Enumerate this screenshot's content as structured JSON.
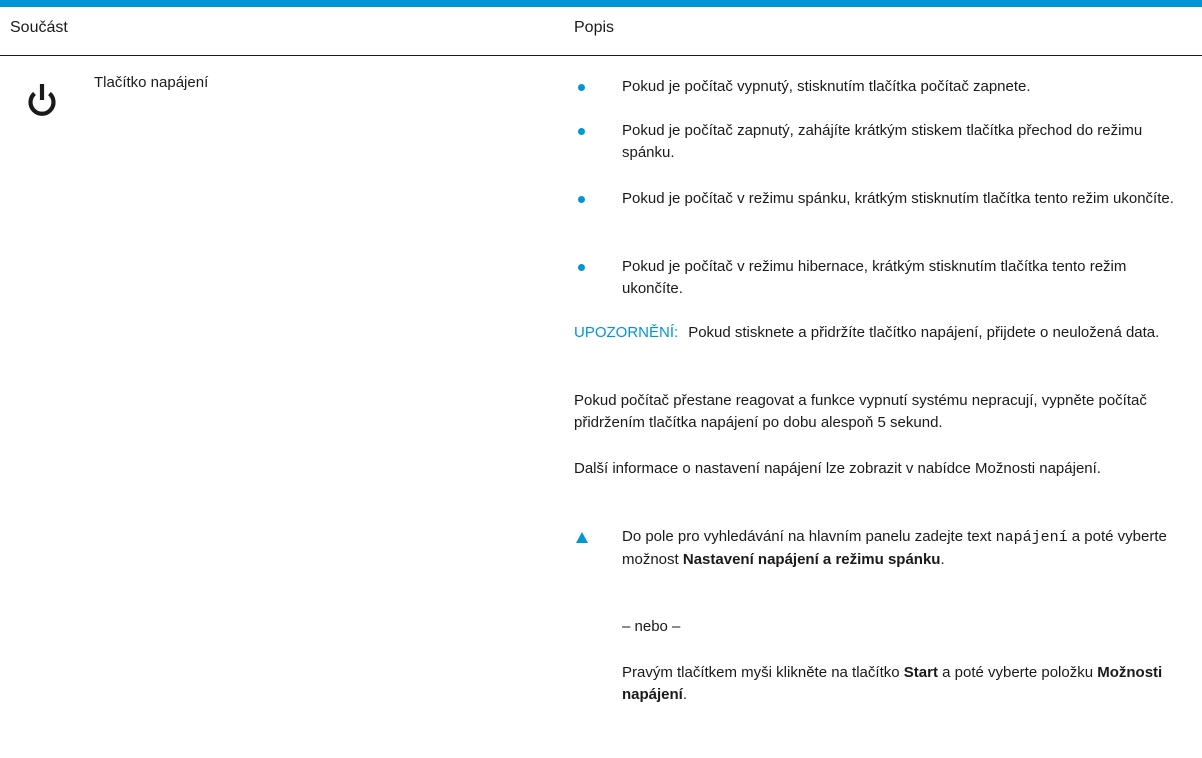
{
  "table": {
    "headers": {
      "component": "Součást",
      "description": "Popis"
    },
    "row": {
      "icon": "power-icon",
      "component_name": "Tlačítko napájení",
      "bullets": [
        "Pokud je počítač vypnutý, stisknutím tlačítka počítač zapnete.",
        "Pokud je počítač zapnutý, zahájíte krátkým stiskem tlačítka přechod do režimu spánku.",
        "Pokud je počítač v režimu spánku, krátkým stisknutím tlačítka tento režim ukončíte.",
        "Pokud je počítač v režimu hibernace, krátkým stisknutím tlačítka tento režim ukončíte."
      ],
      "caution_label": "UPOZORNĚNÍ:",
      "caution_text": "Pokud stisknete a přidržíte tlačítko napájení, přijdete o neuložená data.",
      "para_unresponsive": "Pokud počítač přestane reagovat a funkce vypnutí systému nepracují, vypněte počítač přidržením tlačítka napájení po dobu alespoň 5 sekund.",
      "para_more_info": "Další informace o nastavení napájení lze zobrazit v nabídce Možnosti napájení.",
      "step": {
        "pre": "Do pole pro vyhledávání na hlavním panelu zadejte text",
        "code": "napájení",
        "mid": "a poté vyberte možnost",
        "bold": "Nastavení napájení a režimu spánku",
        "end": "."
      },
      "or_text": "– nebo –",
      "alt_step": {
        "pre": "Pravým tlačítkem myši klikněte na tlačítko",
        "bold1": "Start",
        "mid": "a poté vyberte položku",
        "bold2": "Možnosti napájení",
        "end": "."
      }
    }
  },
  "colors": {
    "accent": "#0096d6",
    "text": "#1a1a1a",
    "background": "#ffffff"
  }
}
